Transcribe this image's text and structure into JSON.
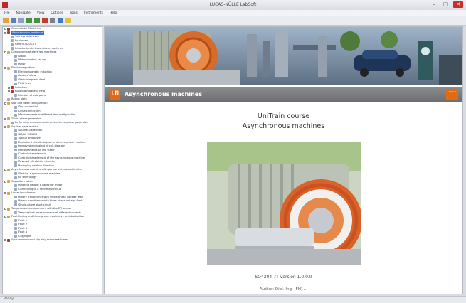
{
  "window": {
    "title": "LUCAS-NÜLLE LabSoft"
  },
  "menu": [
    "File",
    "Navigate",
    "View",
    "Options",
    "Tools",
    "Instruments",
    "Help"
  ],
  "tree": [
    {
      "label": "Commutator Machines",
      "level": 0,
      "icon": "book-icon",
      "expand": "+"
    },
    {
      "label": "Asynchronous machines",
      "level": 0,
      "icon": "book-icon",
      "expand": "-",
      "selected": true
    },
    {
      "label": "Training objectives",
      "level": 1,
      "icon": "page-icon"
    },
    {
      "label": "Equipment",
      "level": 1,
      "icon": "page-icon"
    },
    {
      "label": "Card SO4204-7T",
      "level": 1,
      "icon": "page-icon"
    },
    {
      "label": "Introduction to three-phase machines",
      "level": 1,
      "icon": "page-icon"
    },
    {
      "label": "Components of electrical machines",
      "level": 0,
      "icon": "folder-icon",
      "expand": "-"
    },
    {
      "label": "Stator",
      "level": 2,
      "icon": "page-icon"
    },
    {
      "label": "Motor winding set up",
      "level": 2,
      "icon": "page-icon"
    },
    {
      "label": "Rotor",
      "level": 2,
      "icon": "page-icon"
    },
    {
      "label": "Electromagnetism",
      "level": 0,
      "icon": "folder-icon",
      "expand": "-"
    },
    {
      "label": "Electromagnetic induction",
      "level": 2,
      "icon": "page-icon"
    },
    {
      "label": "Ampere's law",
      "level": 2,
      "icon": "page-icon"
    },
    {
      "label": "Static magnetic field",
      "level": 2,
      "icon": "page-icon"
    },
    {
      "label": "Field lines",
      "level": 2,
      "icon": "page-icon"
    },
    {
      "label": "Induction",
      "level": 1,
      "icon": "book-icon",
      "expand": "+"
    },
    {
      "label": "Rotating magnetic field",
      "level": 1,
      "icon": "book-icon",
      "expand": "+"
    },
    {
      "label": "Number of pole pairs",
      "level": 2,
      "icon": "page-icon"
    },
    {
      "label": "Rating plate",
      "level": 0,
      "icon": "page-icon"
    },
    {
      "label": "Star and delta configuration",
      "level": 0,
      "icon": "folder-icon",
      "expand": "-"
    },
    {
      "label": "Star connection",
      "level": 2,
      "icon": "page-icon"
    },
    {
      "label": "Delta connection",
      "level": 2,
      "icon": "page-icon"
    },
    {
      "label": "Measurements in different star configuration",
      "level": 2,
      "icon": "page-icon"
    },
    {
      "label": "Three-phase generator",
      "level": 0,
      "icon": "folder-icon",
      "expand": "-"
    },
    {
      "label": "Performing measurements on the three-phase generator",
      "level": 1,
      "icon": "page-icon"
    },
    {
      "label": "Squirrel-cage motors",
      "level": 0,
      "icon": "folder-icon",
      "expand": "-"
    },
    {
      "label": "Squirrel-cage rotor",
      "level": 2,
      "icon": "page-icon"
    },
    {
      "label": "SM/AS M03 BB",
      "level": 2,
      "icon": "page-icon"
    },
    {
      "label": "Torque and power",
      "level": 2,
      "icon": "page-icon"
    },
    {
      "label": "Equivalent circuit diagram of a three-phase machine",
      "level": 2,
      "icon": "page-icon"
    },
    {
      "label": "Improved equivalent circuit diagram",
      "level": 2,
      "icon": "page-icon"
    },
    {
      "label": "Measurements on the stator",
      "level": 2,
      "icon": "page-icon"
    },
    {
      "label": "Control characteristic",
      "level": 2,
      "icon": "page-icon"
    },
    {
      "label": "Control characteristic of the asynchronous machine",
      "level": 2,
      "icon": "page-icon"
    },
    {
      "label": "Reversal of rotation direction",
      "level": 2,
      "icon": "page-icon"
    },
    {
      "label": "Reversing rotation direction",
      "level": 2,
      "icon": "page-icon"
    },
    {
      "label": "Asynchronous machine with permanent magnetic rotor",
      "level": 0,
      "icon": "folder-icon",
      "expand": "-"
    },
    {
      "label": "Starting a synchronous machine",
      "level": 2,
      "icon": "page-icon"
    },
    {
      "label": "EF technology",
      "level": 2,
      "icon": "page-icon"
    },
    {
      "label": "Capacitor motors",
      "level": 0,
      "icon": "folder-icon",
      "expand": "-"
    },
    {
      "label": "Rotating field of a capacitor motor",
      "level": 2,
      "icon": "page-icon"
    },
    {
      "label": "Connecting to a Steinmetz circuit",
      "level": 2,
      "icon": "page-icon"
    },
    {
      "label": "Linear transformer",
      "level": 0,
      "icon": "folder-icon",
      "expand": "-"
    },
    {
      "label": "Rotary transformer with single-phase voltage feed",
      "level": 2,
      "icon": "page-icon"
    },
    {
      "label": "Rotary transformer with three-phase voltage feed",
      "level": 2,
      "icon": "page-icon"
    },
    {
      "label": "Single-phase short-circuit",
      "level": 2,
      "icon": "page-icon"
    },
    {
      "label": "Temperature measurement with the EPI sensor",
      "level": 0,
      "icon": "folder-icon",
      "expand": "-"
    },
    {
      "label": "Temperature measurements at different currents",
      "level": 2,
      "icon": "page-icon"
    },
    {
      "label": "Fault finding and three-phase machines - an introduction",
      "level": 0,
      "icon": "folder-icon",
      "expand": "-"
    },
    {
      "label": "Fault 1",
      "level": 2,
      "icon": "page-icon"
    },
    {
      "label": "Fault 2",
      "level": 2,
      "icon": "page-icon"
    },
    {
      "label": "Fault 3",
      "level": 2,
      "icon": "page-icon"
    },
    {
      "label": "Fault 4",
      "level": 2,
      "icon": "page-icon"
    },
    {
      "label": "Copyright",
      "level": 2,
      "icon": "page-icon"
    },
    {
      "label": "Synchronous semi-slip-ring motor machines",
      "level": 0,
      "icon": "book-icon",
      "expand": "+"
    }
  ],
  "header": {
    "logo": "LN",
    "title": "Asynchronous machines",
    "badge": "UniTrain"
  },
  "course": {
    "line1": "UniTrain course",
    "line2": "Asynchronous machines",
    "version": "SO4204-7T  version 1.0.0.0",
    "author": "Author: Dipl.-Ing. (FH) ..."
  },
  "status": {
    "text": "Ready"
  },
  "colors": {
    "accent": "#e26a12",
    "selected": "#3b6fd0",
    "header": "#7c7d80"
  }
}
